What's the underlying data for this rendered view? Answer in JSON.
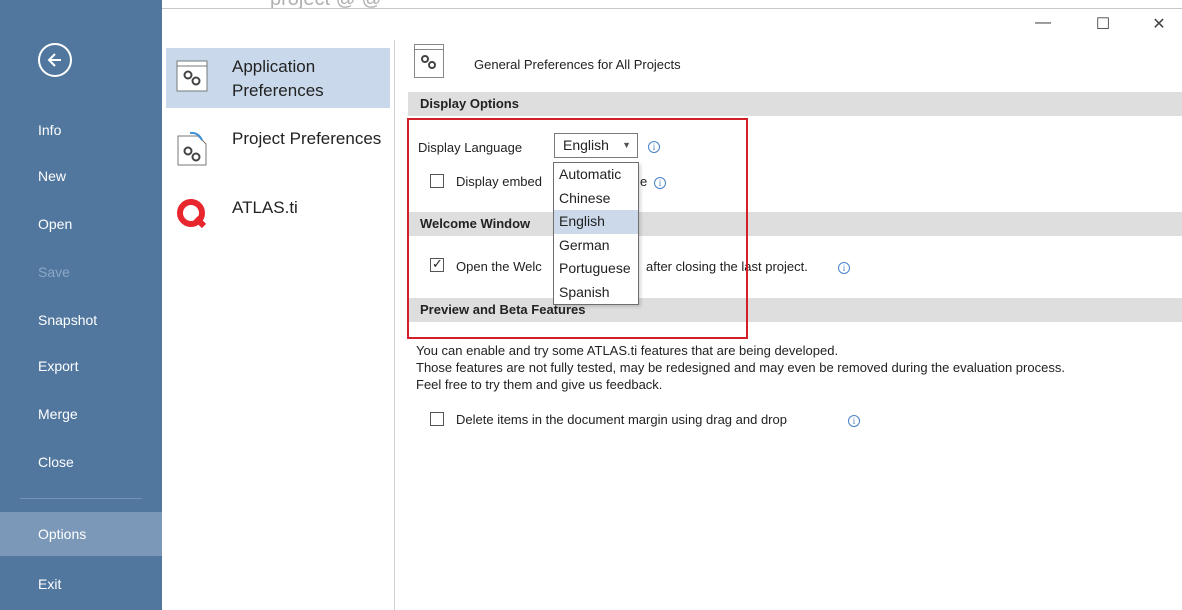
{
  "window": {
    "title_fragment": "project @ @",
    "controls": {
      "minimize": "—",
      "maximize": "☐",
      "close": "✕"
    }
  },
  "nav": {
    "items": [
      {
        "label": "Info"
      },
      {
        "label": "New"
      },
      {
        "label": "Open"
      },
      {
        "label": "Save"
      },
      {
        "label": "Snapshot"
      },
      {
        "label": "Export"
      },
      {
        "label": "Merge"
      },
      {
        "label": "Close"
      },
      {
        "label": "Options"
      },
      {
        "label": "Exit"
      }
    ]
  },
  "categories": [
    {
      "label": "Application Preferences",
      "icon": "gear-window-icon"
    },
    {
      "label": "Project Preferences",
      "icon": "gear-document-icon"
    },
    {
      "label": "ATLAS.ti",
      "icon": "atlas-logo-icon"
    }
  ],
  "content": {
    "header_title": "General Preferences for All Projects",
    "display_options": {
      "title": "Display Options",
      "language_label": "Display Language",
      "language_value": "English",
      "embedded_label_start": "Display embed",
      "embedded_label_end": "e"
    },
    "welcome_window": {
      "title": "Welcome Window",
      "open_label_start": "Open the Welc",
      "open_label_end": "after closing the last project."
    },
    "preview": {
      "title": "Preview and Beta Features",
      "para_1": "You can enable and try some ATLAS.ti features that are being developed.",
      "para_2": "Those features are not fully tested, may be redesigned and may even be removed during the evaluation process.",
      "para_3": "Feel free to try them and give us feedback.",
      "drag_drop_label": "Delete items in the document margin using drag and drop"
    },
    "language_options": [
      "Automatic",
      "Chinese",
      "English",
      "German",
      "Portuguese",
      "Spanish"
    ],
    "language_selected": "English"
  },
  "colors": {
    "nav_bg": "#51779f",
    "nav_active": "#7c98b8",
    "category_selected": "#c9d8ea",
    "section_bg": "#dedede",
    "highlight_box": "#d2202a",
    "atlas_red": "#e8262d"
  }
}
